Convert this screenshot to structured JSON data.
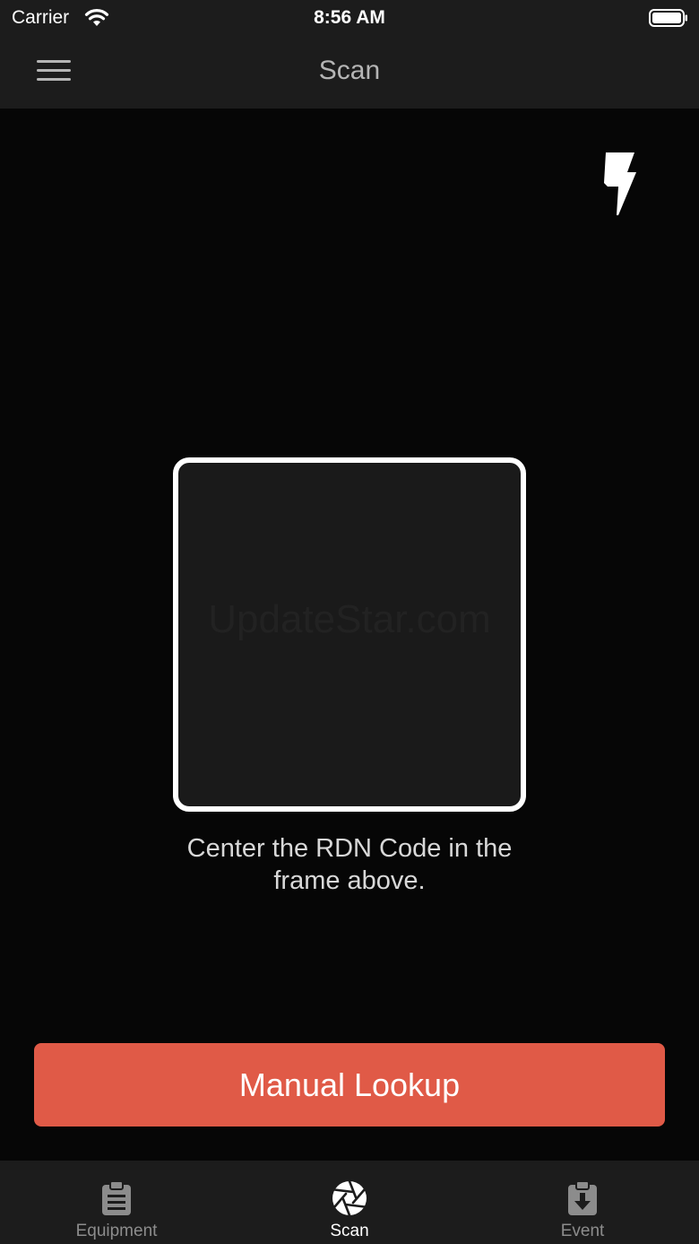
{
  "status_bar": {
    "carrier": "Carrier",
    "time": "8:56 AM"
  },
  "nav": {
    "title": "Scan",
    "menu_icon": "hamburger-menu-icon"
  },
  "scanner": {
    "flash_icon": "flash-icon",
    "watermark": "UpdateStar.com",
    "instruction": "Center the RDN Code in the frame above."
  },
  "actions": {
    "manual_lookup_label": "Manual Lookup",
    "accent_color": "#e05a47"
  },
  "tab_bar": {
    "tabs": [
      {
        "label": "Equipment",
        "icon": "clipboard-icon",
        "active": false
      },
      {
        "label": "Scan",
        "icon": "aperture-icon",
        "active": true
      },
      {
        "label": "Event",
        "icon": "clipboard-download-icon",
        "active": false
      }
    ]
  }
}
